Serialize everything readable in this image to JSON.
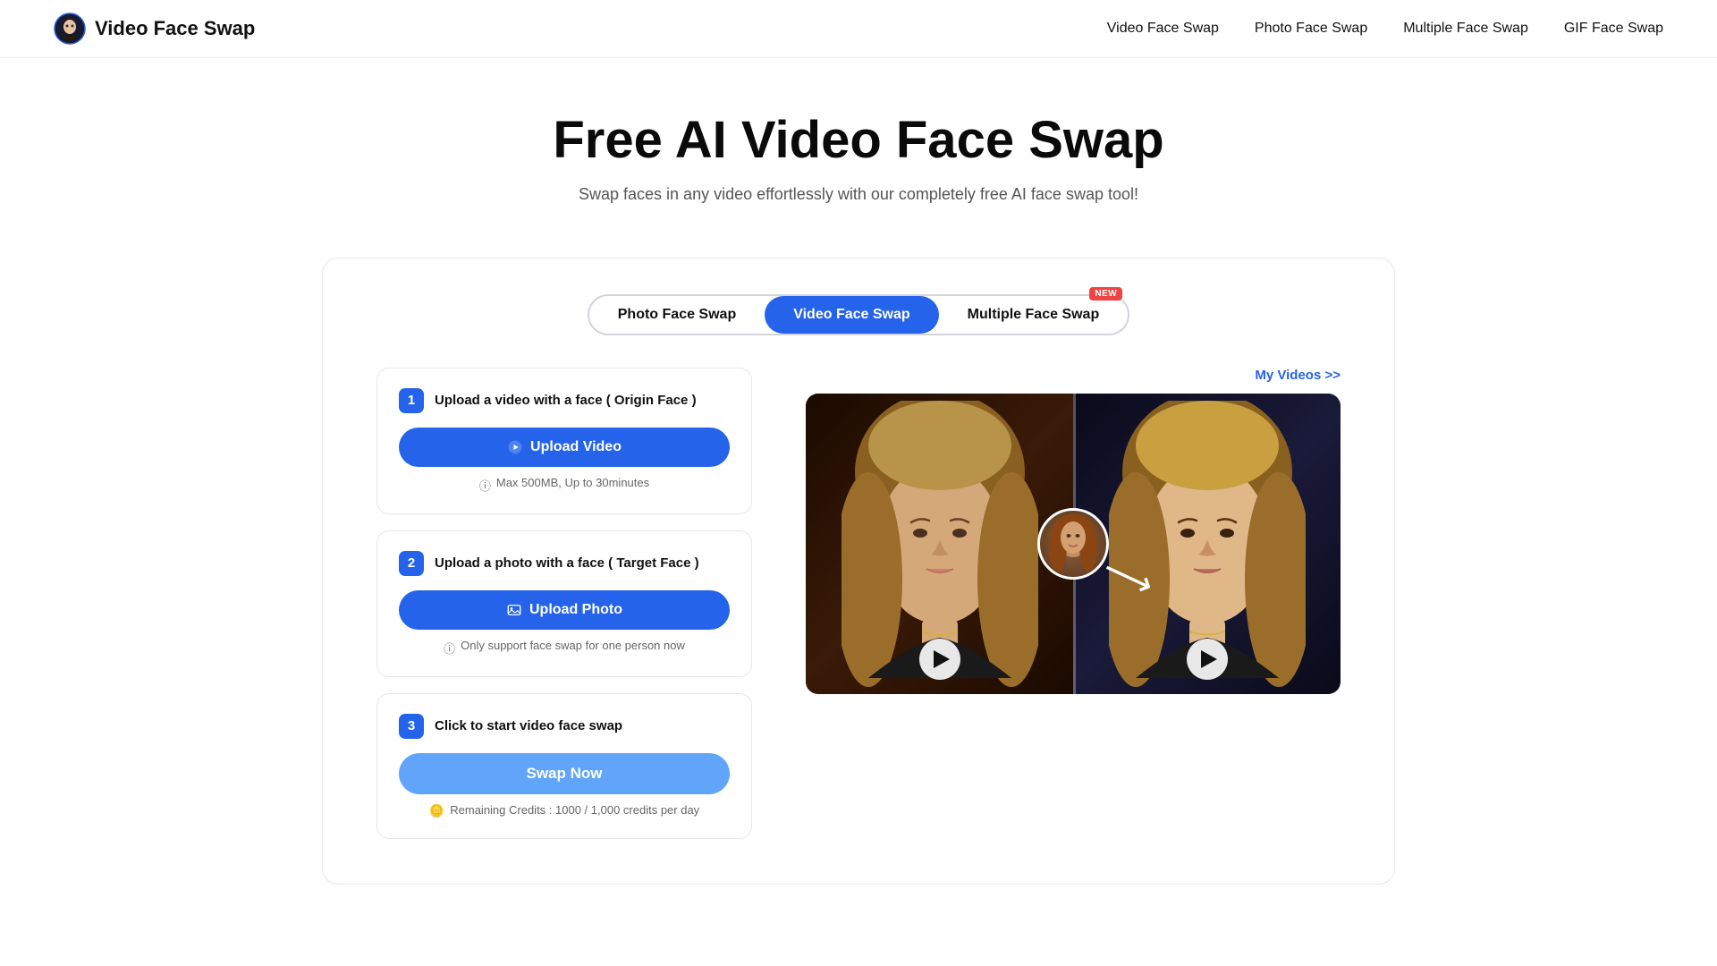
{
  "nav": {
    "logo_text": "Video Face Swap",
    "links": [
      "Video Face Swap",
      "Photo Face Swap",
      "Multiple Face Swap",
      "GIF Face Swap"
    ]
  },
  "hero": {
    "title": "Free AI Video Face Swap",
    "subtitle": "Swap faces in any video effortlessly with our completely free AI face swap tool!"
  },
  "tabs": {
    "items": [
      {
        "id": "photo",
        "label": "Photo Face Swap",
        "active": false,
        "new": false
      },
      {
        "id": "video",
        "label": "Video Face Swap",
        "active": true,
        "new": false
      },
      {
        "id": "multiple",
        "label": "Multiple Face Swap",
        "active": false,
        "new": true
      }
    ],
    "new_badge": "NEW"
  },
  "my_videos_link": "My Videos >>",
  "steps": [
    {
      "num": "1",
      "title": "Upload a video with a face ( Origin Face )",
      "btn_label": "Upload Video",
      "note": "Max 500MB, Up to 30minutes",
      "note_icon": "ⓘ"
    },
    {
      "num": "2",
      "title": "Upload a photo with a face ( Target Face )",
      "btn_label": "Upload Photo",
      "note": "Only support face swap for one person now",
      "note_icon": "ⓘ"
    },
    {
      "num": "3",
      "title": "Click to start video face swap",
      "btn_label": "Swap Now",
      "credits_icon": "🪙",
      "credits_note": "Remaining Credits : 1000 / 1,000 credits per day"
    }
  ],
  "icons": {
    "play": "▶",
    "upload_video": "▶",
    "upload_photo": "🖼",
    "arrow": "→",
    "swap_arrow": "→"
  }
}
